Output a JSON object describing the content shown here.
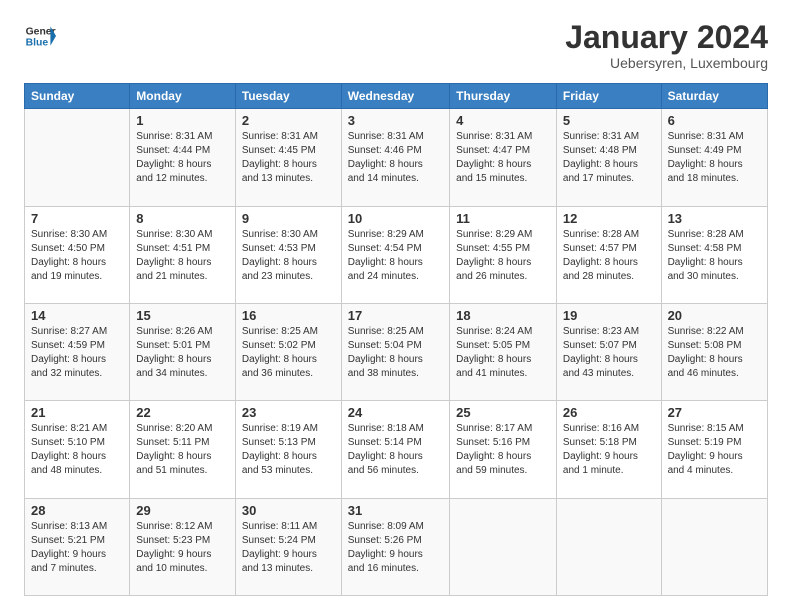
{
  "header": {
    "logo_general": "General",
    "logo_blue": "Blue",
    "month_title": "January 2024",
    "location": "Uebersyren, Luxembourg"
  },
  "weekdays": [
    "Sunday",
    "Monday",
    "Tuesday",
    "Wednesday",
    "Thursday",
    "Friday",
    "Saturday"
  ],
  "weeks": [
    [
      {
        "day": "",
        "info": ""
      },
      {
        "day": "1",
        "info": "Sunrise: 8:31 AM\nSunset: 4:44 PM\nDaylight: 8 hours\nand 12 minutes."
      },
      {
        "day": "2",
        "info": "Sunrise: 8:31 AM\nSunset: 4:45 PM\nDaylight: 8 hours\nand 13 minutes."
      },
      {
        "day": "3",
        "info": "Sunrise: 8:31 AM\nSunset: 4:46 PM\nDaylight: 8 hours\nand 14 minutes."
      },
      {
        "day": "4",
        "info": "Sunrise: 8:31 AM\nSunset: 4:47 PM\nDaylight: 8 hours\nand 15 minutes."
      },
      {
        "day": "5",
        "info": "Sunrise: 8:31 AM\nSunset: 4:48 PM\nDaylight: 8 hours\nand 17 minutes."
      },
      {
        "day": "6",
        "info": "Sunrise: 8:31 AM\nSunset: 4:49 PM\nDaylight: 8 hours\nand 18 minutes."
      }
    ],
    [
      {
        "day": "7",
        "info": "Sunrise: 8:30 AM\nSunset: 4:50 PM\nDaylight: 8 hours\nand 19 minutes."
      },
      {
        "day": "8",
        "info": "Sunrise: 8:30 AM\nSunset: 4:51 PM\nDaylight: 8 hours\nand 21 minutes."
      },
      {
        "day": "9",
        "info": "Sunrise: 8:30 AM\nSunset: 4:53 PM\nDaylight: 8 hours\nand 23 minutes."
      },
      {
        "day": "10",
        "info": "Sunrise: 8:29 AM\nSunset: 4:54 PM\nDaylight: 8 hours\nand 24 minutes."
      },
      {
        "day": "11",
        "info": "Sunrise: 8:29 AM\nSunset: 4:55 PM\nDaylight: 8 hours\nand 26 minutes."
      },
      {
        "day": "12",
        "info": "Sunrise: 8:28 AM\nSunset: 4:57 PM\nDaylight: 8 hours\nand 28 minutes."
      },
      {
        "day": "13",
        "info": "Sunrise: 8:28 AM\nSunset: 4:58 PM\nDaylight: 8 hours\nand 30 minutes."
      }
    ],
    [
      {
        "day": "14",
        "info": "Sunrise: 8:27 AM\nSunset: 4:59 PM\nDaylight: 8 hours\nand 32 minutes."
      },
      {
        "day": "15",
        "info": "Sunrise: 8:26 AM\nSunset: 5:01 PM\nDaylight: 8 hours\nand 34 minutes."
      },
      {
        "day": "16",
        "info": "Sunrise: 8:25 AM\nSunset: 5:02 PM\nDaylight: 8 hours\nand 36 minutes."
      },
      {
        "day": "17",
        "info": "Sunrise: 8:25 AM\nSunset: 5:04 PM\nDaylight: 8 hours\nand 38 minutes."
      },
      {
        "day": "18",
        "info": "Sunrise: 8:24 AM\nSunset: 5:05 PM\nDaylight: 8 hours\nand 41 minutes."
      },
      {
        "day": "19",
        "info": "Sunrise: 8:23 AM\nSunset: 5:07 PM\nDaylight: 8 hours\nand 43 minutes."
      },
      {
        "day": "20",
        "info": "Sunrise: 8:22 AM\nSunset: 5:08 PM\nDaylight: 8 hours\nand 46 minutes."
      }
    ],
    [
      {
        "day": "21",
        "info": "Sunrise: 8:21 AM\nSunset: 5:10 PM\nDaylight: 8 hours\nand 48 minutes."
      },
      {
        "day": "22",
        "info": "Sunrise: 8:20 AM\nSunset: 5:11 PM\nDaylight: 8 hours\nand 51 minutes."
      },
      {
        "day": "23",
        "info": "Sunrise: 8:19 AM\nSunset: 5:13 PM\nDaylight: 8 hours\nand 53 minutes."
      },
      {
        "day": "24",
        "info": "Sunrise: 8:18 AM\nSunset: 5:14 PM\nDaylight: 8 hours\nand 56 minutes."
      },
      {
        "day": "25",
        "info": "Sunrise: 8:17 AM\nSunset: 5:16 PM\nDaylight: 8 hours\nand 59 minutes."
      },
      {
        "day": "26",
        "info": "Sunrise: 8:16 AM\nSunset: 5:18 PM\nDaylight: 9 hours\nand 1 minute."
      },
      {
        "day": "27",
        "info": "Sunrise: 8:15 AM\nSunset: 5:19 PM\nDaylight: 9 hours\nand 4 minutes."
      }
    ],
    [
      {
        "day": "28",
        "info": "Sunrise: 8:13 AM\nSunset: 5:21 PM\nDaylight: 9 hours\nand 7 minutes."
      },
      {
        "day": "29",
        "info": "Sunrise: 8:12 AM\nSunset: 5:23 PM\nDaylight: 9 hours\nand 10 minutes."
      },
      {
        "day": "30",
        "info": "Sunrise: 8:11 AM\nSunset: 5:24 PM\nDaylight: 9 hours\nand 13 minutes."
      },
      {
        "day": "31",
        "info": "Sunrise: 8:09 AM\nSunset: 5:26 PM\nDaylight: 9 hours\nand 16 minutes."
      },
      {
        "day": "",
        "info": ""
      },
      {
        "day": "",
        "info": ""
      },
      {
        "day": "",
        "info": ""
      }
    ]
  ]
}
